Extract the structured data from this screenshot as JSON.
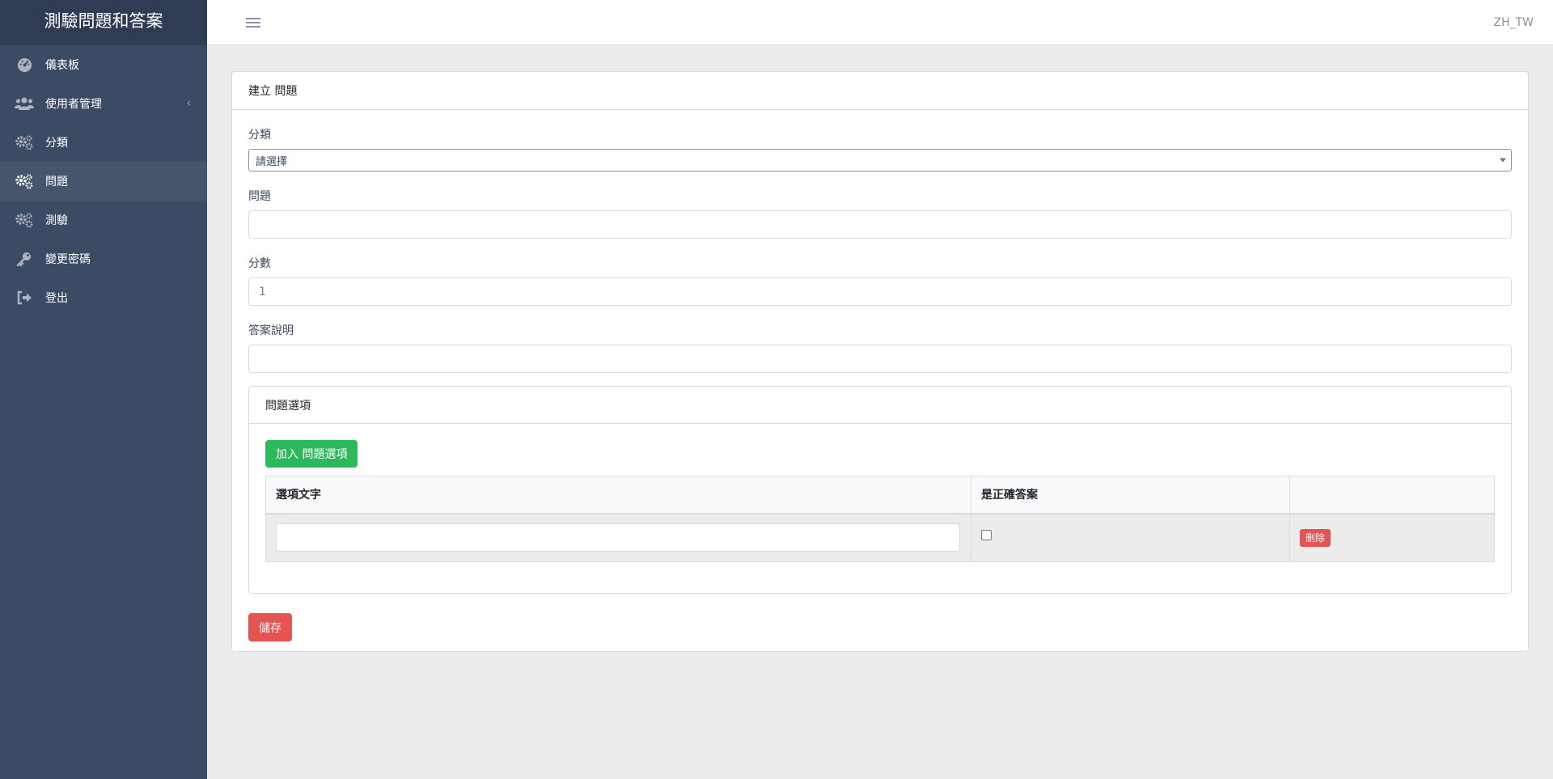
{
  "sidebar": {
    "brand": "測驗問題和答案",
    "items": [
      {
        "label": "儀表板",
        "icon": "speedometer-icon"
      },
      {
        "label": "使用者管理",
        "icon": "users-icon",
        "caret": "‹"
      },
      {
        "label": "分類",
        "icon": "cogs-icon"
      },
      {
        "label": "問題",
        "icon": "cogs-icon",
        "active": true
      },
      {
        "label": "測驗",
        "icon": "cogs-icon"
      },
      {
        "label": "變更密碼",
        "icon": "key-icon"
      },
      {
        "label": "登出",
        "icon": "logout-icon"
      }
    ]
  },
  "header": {
    "locale": "ZH_TW"
  },
  "form": {
    "card_title": "建立 問題",
    "category_label": "分類",
    "category_selected": "請選擇",
    "question_label": "問題",
    "question_value": "",
    "score_label": "分數",
    "score_value": "1",
    "explanation_label": "答案說明",
    "explanation_value": "",
    "options": {
      "title": "問題選項",
      "add_button": "加入 問題選項",
      "columns": [
        "選項文字",
        "是正確答案",
        ""
      ],
      "rows": [
        {
          "text": "",
          "correct": false,
          "delete_label": "刪除"
        }
      ]
    },
    "save_button": "儲存"
  },
  "colors": {
    "sidebar": "#3c4b64",
    "brand_bg": "#303c54",
    "success": "#2eb85c",
    "danger": "#e55353",
    "page_bg": "#ebedef"
  }
}
